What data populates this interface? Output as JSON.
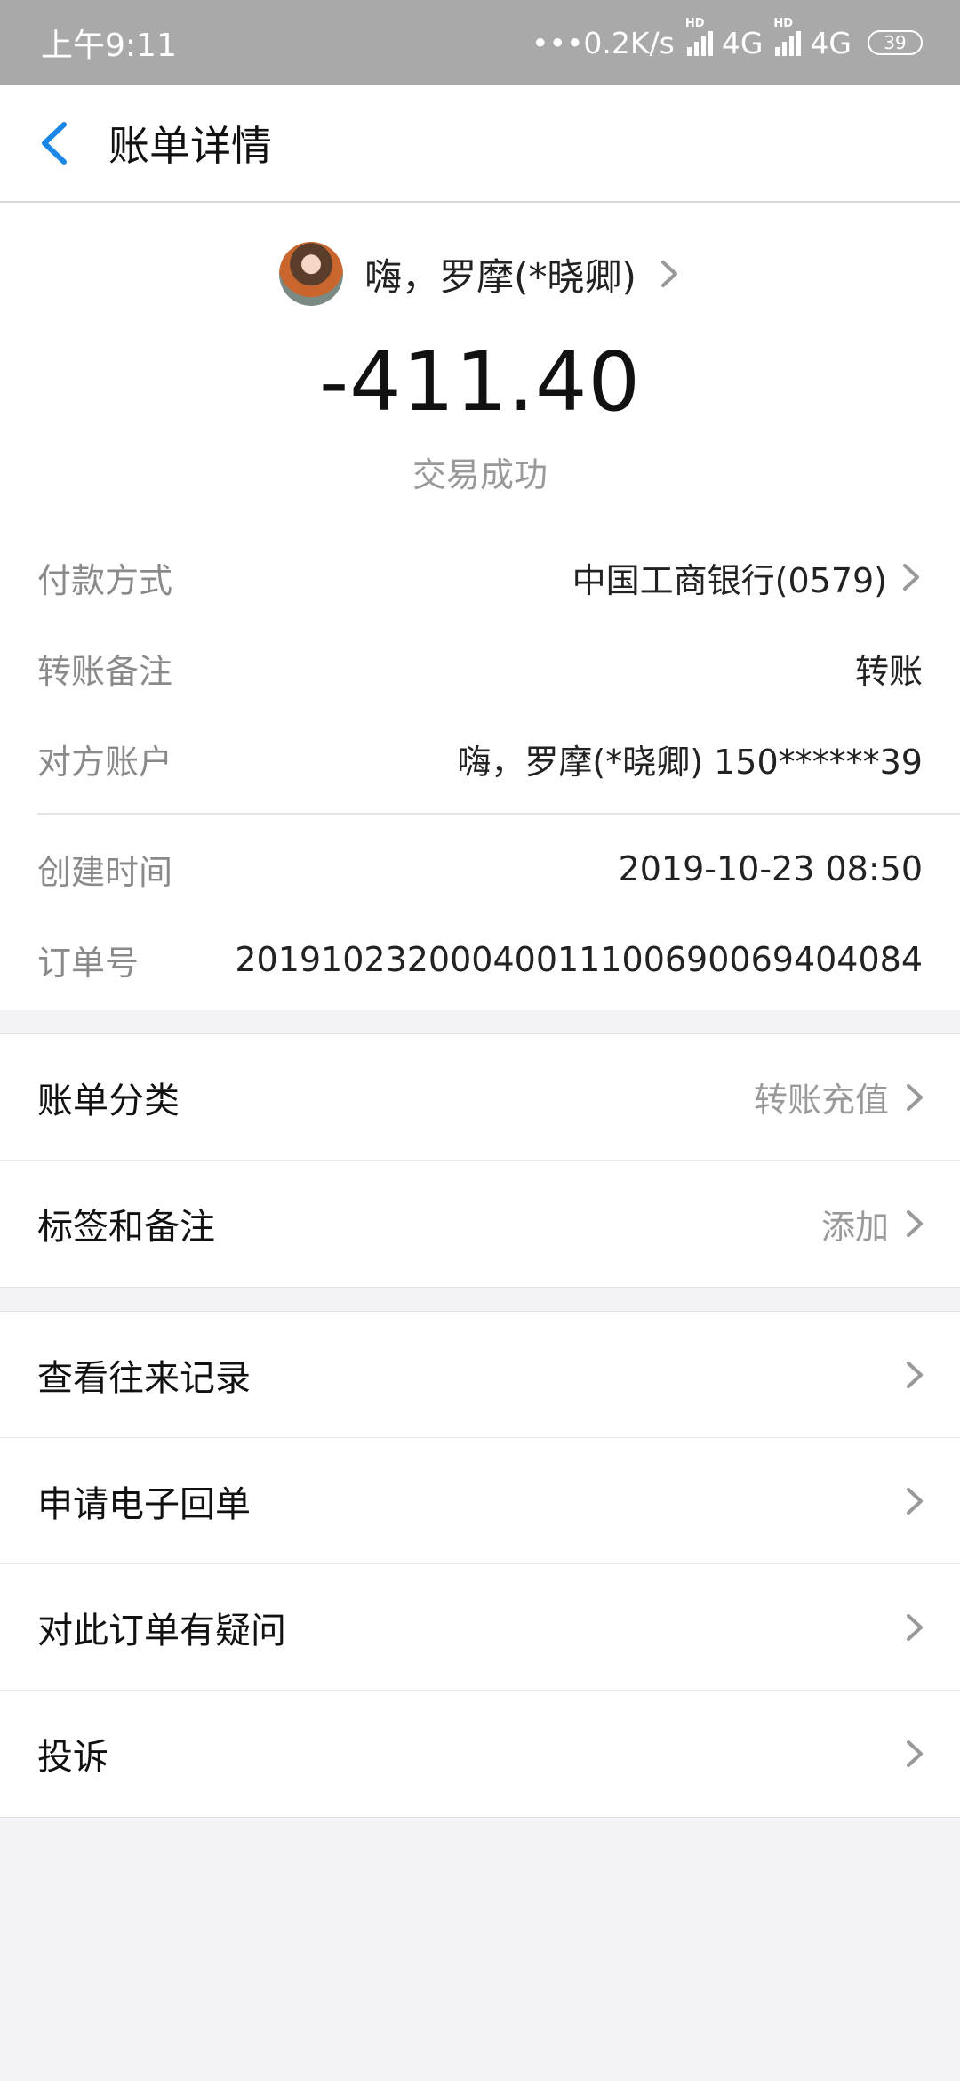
{
  "status_bar": {
    "time": "上午9:11",
    "net_speed": "•••0.2K/s",
    "net1": "4G",
    "net2": "4G",
    "battery": "39"
  },
  "nav": {
    "title": "账单详情"
  },
  "payee": {
    "name": "嗨，罗摩(*晓卿)"
  },
  "amount": "-411.40",
  "status": "交易成功",
  "details": [
    {
      "label": "付款方式",
      "value": "中国工商银行(0579)",
      "chevron": true
    },
    {
      "label": "转账备注",
      "value": "转账"
    },
    {
      "label": "对方账户",
      "value": "嗨，罗摩(*晓卿) 150******39"
    }
  ],
  "times": [
    {
      "label": "创建时间",
      "value": "2019-10-23 08:50"
    },
    {
      "label": "订单号",
      "value": "20191023200040011100690069404084"
    }
  ],
  "group1": [
    {
      "label": "账单分类",
      "value": "转账充值"
    },
    {
      "label": "标签和备注",
      "value": "添加"
    }
  ],
  "group2": [
    {
      "label": "查看往来记录"
    },
    {
      "label": "申请电子回单"
    },
    {
      "label": "对此订单有疑问"
    },
    {
      "label": "投诉"
    }
  ]
}
